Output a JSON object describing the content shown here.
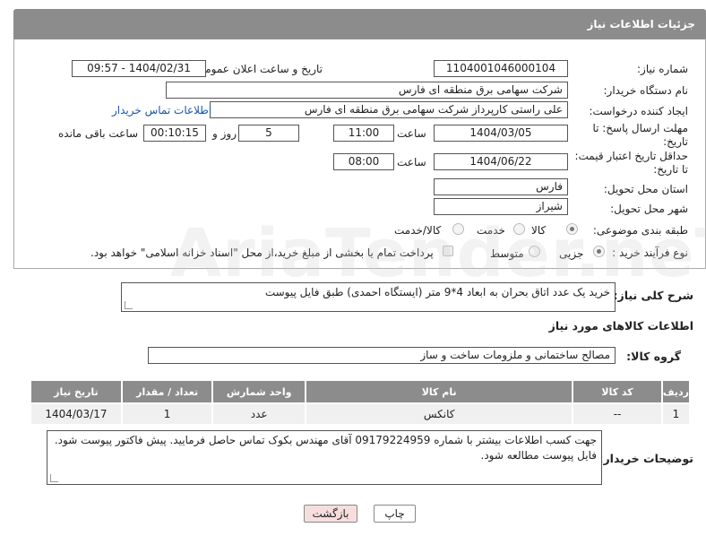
{
  "header": {
    "title": "جزئیات اطلاعات نیاز"
  },
  "fields": {
    "need_number_label": "شماره نیاز:",
    "need_number": "1104001046000104",
    "announce_label": "تاریخ و ساعت اعلان عمومی:",
    "announce_value": "1404/02/31 - 09:57",
    "buyer_org_label": "نام دستگاه خریدار:",
    "buyer_org": "شرکت سهامی برق منطقه ای فارس",
    "requester_label": "ایجاد کننده درخواست:",
    "requester": "علی راستی کارپرداز شرکت سهامی برق منطقه ای فارس",
    "contact_link": "اطلاعات تماس خریدار",
    "deadline_label_1": "مهلت ارسال پاسخ: تا",
    "deadline_label_2": "تاریخ:",
    "deadline_date": "1404/03/05",
    "time_label": "ساعت",
    "deadline_time": "11:00",
    "days_value": "5",
    "days_label": "روز و",
    "remaining_value": "00:10:15",
    "remaining_label": "ساعت باقی مانده",
    "validity_label_1": "حداقل تاریخ اعتبار قیمت:",
    "validity_label_2": "تا تاریخ:",
    "validity_date": "1404/06/22",
    "validity_time": "08:00",
    "province_label": "استان محل تحویل:",
    "province": "فارس",
    "city_label": "شهر محل تحویل:",
    "city": "شیراز",
    "category_label": "طبقه بندی موضوعی:",
    "category_options": [
      "کالا",
      "خدمت",
      "کالا/خدمت"
    ],
    "category_selected": "کالا",
    "process_label": "نوع فرآیند خرید :",
    "process_options": [
      "جزیی",
      "متوسط"
    ],
    "process_selected": "جزیی",
    "process_note": "پرداخت تمام یا بخشی از مبلغ خرید،از محل \"اسناد خزانه اسلامی\" خواهد بود."
  },
  "description": {
    "label": "شرح کلی نیاز:",
    "text": "خرید یک عدد اتاق بحران به ابعاد 4*9 متر (ایستگاه احمدی) طبق فایل پیوست"
  },
  "goods": {
    "section_title": "اطلاعات کالاهای مورد نیاز",
    "group_label": "گروه کالا:",
    "group_value": "مصالح ساختمانی و ملزومات ساخت و ساز",
    "columns": [
      "ردیف",
      "کد کالا",
      "نام کالا",
      "واحد شمارش",
      "تعداد / مقدار",
      "تاریخ نیاز"
    ],
    "rows": [
      [
        "1",
        "--",
        "کانکس",
        "عدد",
        "1",
        "1404/03/17"
      ]
    ]
  },
  "buyer_notes": {
    "label": "توضیحات خریدار:",
    "text": "جهت کسب اطلاعات بیشتر با شماره 09179224959 آقای مهندس بکوک تماس حاصل فرمایید. پیش فاکتور پیوست شود. فایل پیوست مطالعه شود."
  },
  "buttons": {
    "print": "چاپ",
    "back": "بازگشت"
  },
  "watermark": "AriaTender.neT",
  "colors": {
    "header_bg": "#8c8c8c",
    "link": "#1a57a6",
    "back_btn": "#f7dede"
  }
}
